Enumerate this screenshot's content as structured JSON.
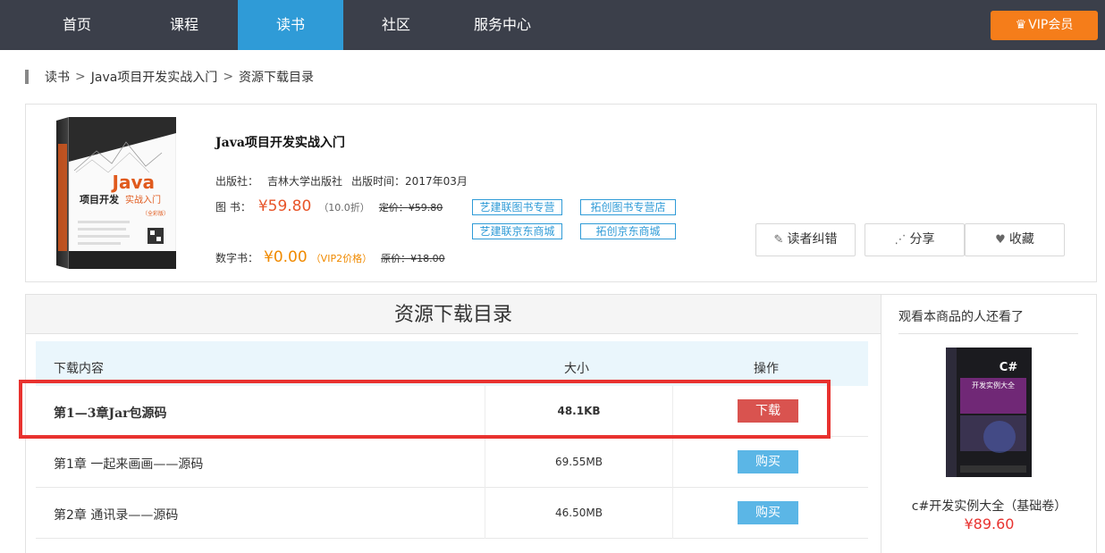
{
  "nav": {
    "items": [
      {
        "label": "首页"
      },
      {
        "label": "课程"
      },
      {
        "label": "读书"
      },
      {
        "label": "社区"
      },
      {
        "label": "服务中心"
      }
    ],
    "active_index": 2,
    "vip_label": "VIP会员",
    "vip_icon": "crown-icon",
    "active_color": "#2f9bd7",
    "bg_color": "#3b3f4a"
  },
  "breadcrumb": {
    "items": [
      "读书",
      "Java项目开发实战入门",
      "资源下载目录"
    ],
    "separator": ">"
  },
  "book": {
    "title": "Java项目开发实战入门",
    "publisher_label": "出版社：",
    "publisher": "吉林大学出版社",
    "pubdate_label": "出版时间：",
    "pubdate": "2017年03月",
    "print_label": "图 书：",
    "print_price": "¥59.80",
    "print_discount": "（10.0折）",
    "print_orig_label": "定价：",
    "print_orig": "¥59.80",
    "digital_label": "数字书：",
    "digital_price": "¥0.00",
    "digital_vip": "（VIP2价格）",
    "digital_orig_label": "原价：",
    "digital_orig": "¥18.00",
    "cover_text": {
      "title": "Java",
      "subtitle1": "项目开发",
      "subtitle2": "实战入门",
      "edition": "（全彩版）"
    },
    "stores": [
      "艺建联图书专营",
      "拓创图书专营店",
      "艺建联京东商城",
      "拓创京东商城"
    ],
    "actions": [
      {
        "label": "读者纠错",
        "icon": "pencil-icon"
      },
      {
        "label": "分享",
        "icon": "share-icon"
      },
      {
        "label": "收藏",
        "icon": "heart-icon"
      }
    ]
  },
  "resources": {
    "title": "资源下载目录",
    "headers": {
      "name": "下载内容",
      "size": "大小",
      "op": "操作"
    },
    "rows": [
      {
        "name": "第1—3章Jar包源码",
        "size": "48.1KB",
        "op": "下载"
      },
      {
        "name": "第1章 一起来画画——源码",
        "size": "69.55MB",
        "op": "购买"
      },
      {
        "name": "第2章 通讯录——源码",
        "size": "46.50MB",
        "op": "购买"
      }
    ]
  },
  "side": {
    "title": "观看本商品的人还看了",
    "book_name": "c#开发实例大全（基础卷）",
    "book_price": "¥89.60",
    "cover_text": {
      "title": "C#",
      "subtitle": "开发实例大全"
    }
  }
}
